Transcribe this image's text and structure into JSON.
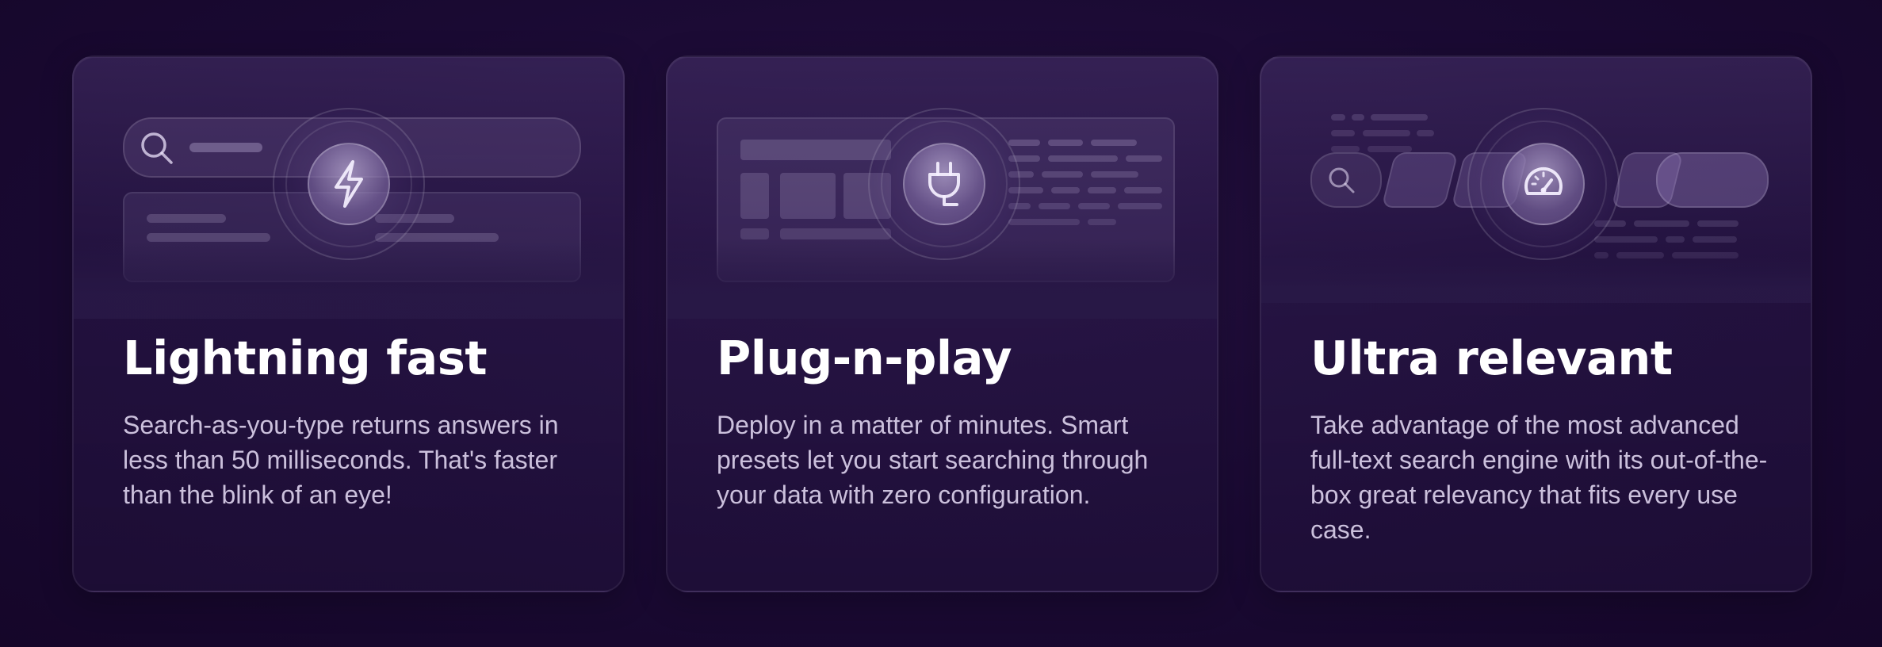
{
  "cards": [
    {
      "icon": "lightning-icon",
      "title": "Lightning fast",
      "description": "Search-as-you-type returns answers in less than 50 milliseconds. That's faster than the blink of an eye!"
    },
    {
      "icon": "plug-icon",
      "title": "Plug-n-play",
      "description": "Deploy in a matter of minutes. Smart presets let you start searching through your data with zero configuration."
    },
    {
      "icon": "speedometer-icon",
      "title": "Ultra relevant",
      "description": "Take advantage of the most advanced full-text search engine with its out-of-the-box great relevancy that fits every use case."
    }
  ],
  "colors": {
    "background": "#1a0a33",
    "title": "#ffffff",
    "description": "#cbc0dc"
  }
}
